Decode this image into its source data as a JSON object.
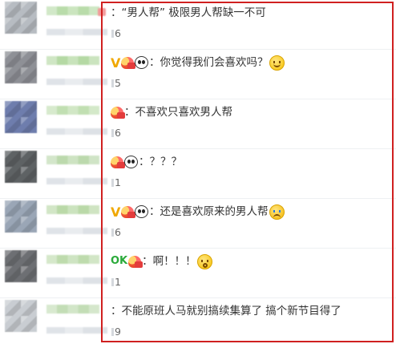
{
  "comments": [
    {
      "text": "：“男人帮” 极限男人帮缺一不可",
      "count": "6",
      "icons": [],
      "avatar_color": "#b7bcc2",
      "name_color": "#b9dcaa"
    },
    {
      "text": "：你觉得我们会喜欢吗？",
      "count": "5",
      "icons": [
        "vip-icon",
        "heart-badge-icon",
        "panda-icon"
      ],
      "trailing_icon": "smile-icon",
      "avatar_color": "#8e9096",
      "name_color": "#b5d9a4"
    },
    {
      "text": "：不喜欢只喜欢男人帮",
      "count": "6",
      "icons": [
        "heart-badge-icon"
      ],
      "avatar_color": "#6e7dad",
      "name_color": "#c1dfb2"
    },
    {
      "text": "：？？？",
      "count": "1",
      "icons": [
        "heart-badge-icon",
        "panda-icon"
      ],
      "avatar_color": "#5e6264",
      "name_color": "#bcd9ad"
    },
    {
      "text": "：还是喜欢原来的男人帮",
      "count": "6",
      "icons": [
        "vip-icon",
        "heart-badge-icon",
        "panda-icon"
      ],
      "trailing_icon": "crying-face-icon",
      "avatar_color": "#9aa6b6",
      "name_color": "#bad9a8"
    },
    {
      "text": "：啊！！！",
      "count": "1",
      "icons": [
        "ok-icon",
        "heart-badge-icon"
      ],
      "trailing_icon": "shocked-face-icon",
      "avatar_color": "#6d6f73",
      "name_color": "#bedbad"
    },
    {
      "text": "：不能原班人马就别搞续集算了 搞个新节目得了",
      "count": "9",
      "icons": [],
      "avatar_color": "#c9cdd2",
      "name_color": "#c3ddb6"
    }
  ],
  "ok_label": "OK",
  "highlight_color": "#d02020"
}
